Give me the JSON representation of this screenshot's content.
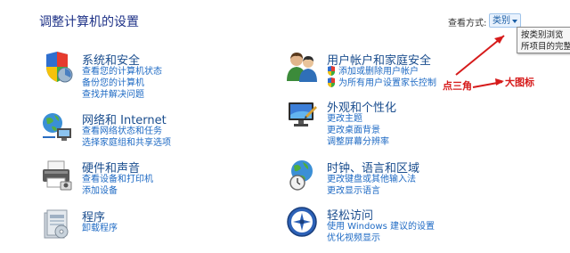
{
  "header": {
    "title": "调整计算机的设置",
    "view_by_label": "查看方式:",
    "view_by_value": "类别"
  },
  "tooltip": {
    "line1": "按类别浏览",
    "line2": "所项目的完整"
  },
  "categories": [
    {
      "title": "系统和安全",
      "icon": "shield-icon",
      "links": [
        "查看您的计算机状态",
        "备份您的计算机",
        "查找并解决问题"
      ]
    },
    {
      "title": "网络和 Internet",
      "icon": "network-icon",
      "links": [
        "查看网络状态和任务",
        "选择家庭组和共享选项"
      ]
    },
    {
      "title": "硬件和声音",
      "icon": "printer-icon",
      "links": [
        "查看设备和打印机",
        "添加设备"
      ]
    },
    {
      "title": "程序",
      "icon": "programs-icon",
      "links": [
        "卸载程序"
      ]
    },
    {
      "title": "用户帐户和家庭安全",
      "icon": "users-icon",
      "links": [
        "添加或删除用户帐户",
        "为所有用户设置家长控制"
      ]
    },
    {
      "title": "外观和个性化",
      "icon": "monitor-icon",
      "links": [
        "更改主题",
        "更改桌面背景",
        "调整屏幕分辨率"
      ]
    },
    {
      "title": "时钟、语言和区域",
      "icon": "globe-clock-icon",
      "links": [
        "更改键盘或其他输入法",
        "更改显示语言"
      ]
    },
    {
      "title": "轻松访问",
      "icon": "ease-of-access-icon",
      "links": [
        "使用 Windows 建议的设置",
        "优化视频显示"
      ]
    }
  ],
  "annotations": {
    "dropdown_arrow": "点三角",
    "large_icons": "大图标"
  },
  "colors": {
    "link": "#1e6ac4",
    "heading": "#1a4d8e",
    "annotation": "#d61b1b"
  }
}
